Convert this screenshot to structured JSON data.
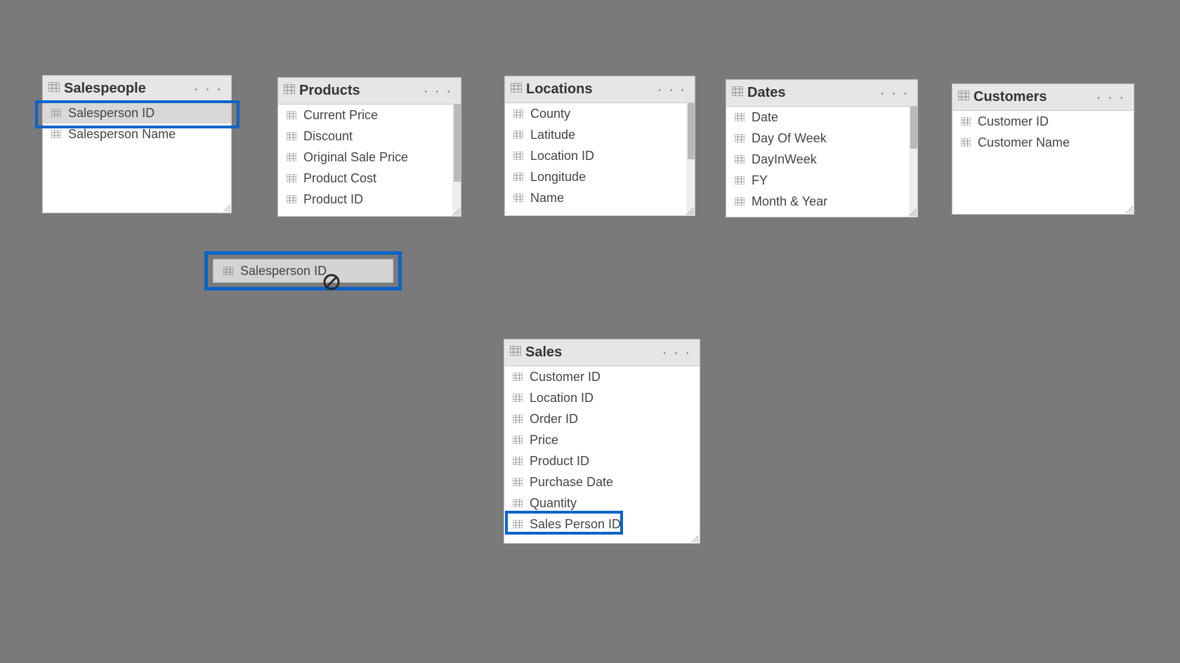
{
  "tables": {
    "salespeople": {
      "title": "Salespeople",
      "fields": [
        "Salesperson ID",
        "Salesperson Name"
      ]
    },
    "products": {
      "title": "Products",
      "fields": [
        "Current Price",
        "Discount",
        "Original Sale Price",
        "Product Cost",
        "Product ID"
      ]
    },
    "locations": {
      "title": "Locations",
      "fields": [
        "County",
        "Latitude",
        "Location ID",
        "Longitude",
        "Name"
      ]
    },
    "dates": {
      "title": "Dates",
      "fields": [
        "Date",
        "Day Of Week",
        "DayInWeek",
        "FY",
        "Month & Year"
      ]
    },
    "customers": {
      "title": "Customers",
      "fields": [
        "Customer ID",
        "Customer Name"
      ]
    },
    "sales": {
      "title": "Sales",
      "fields": [
        "Customer ID",
        "Location ID",
        "Order ID",
        "Price",
        "Product ID",
        "Purchase Date",
        "Quantity",
        "Sales Person ID"
      ]
    }
  },
  "drag_ghost": {
    "label": "Salesperson ID"
  },
  "ellipsis": "· · ·"
}
